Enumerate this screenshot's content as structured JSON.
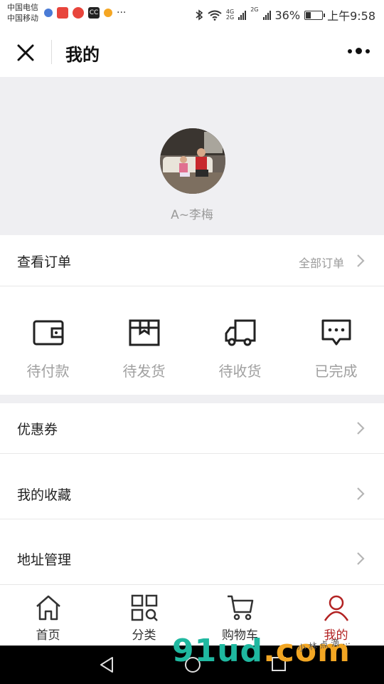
{
  "status_bar": {
    "carrier1": "中国电信",
    "carrier2": "中国移动",
    "net1": "4G",
    "net2": "2G",
    "battery": "36%",
    "battery_level": 0.36,
    "time": "上午9:58",
    "more": "···"
  },
  "navbar": {
    "title": "我的"
  },
  "profile": {
    "username": "A~李梅"
  },
  "orders": {
    "title": "查看订单",
    "all_label": "全部订单",
    "items": [
      {
        "label": "待付款",
        "icon": "wallet-icon"
      },
      {
        "label": "待发货",
        "icon": "box-icon"
      },
      {
        "label": "待收货",
        "icon": "truck-icon"
      },
      {
        "label": "已完成",
        "icon": "chat-dots-icon"
      }
    ]
  },
  "menu": [
    {
      "label": "优惠券"
    },
    {
      "label": "我的收藏"
    },
    {
      "label": "地址管理"
    }
  ],
  "tabs": [
    {
      "label": "首页",
      "icon": "home-icon"
    },
    {
      "label": "分类",
      "icon": "category-icon"
    },
    {
      "label": "购物车",
      "icon": "cart-icon"
    },
    {
      "label": "我的",
      "icon": "user-icon",
      "active": true
    }
  ],
  "colors": {
    "accent": "#b22222",
    "muted": "#9a9a9a",
    "band": "#efeff2"
  },
  "watermark": {
    "main": "91ud",
    "suffix": ".com",
    "small": "小 林 点 滴 ..."
  }
}
